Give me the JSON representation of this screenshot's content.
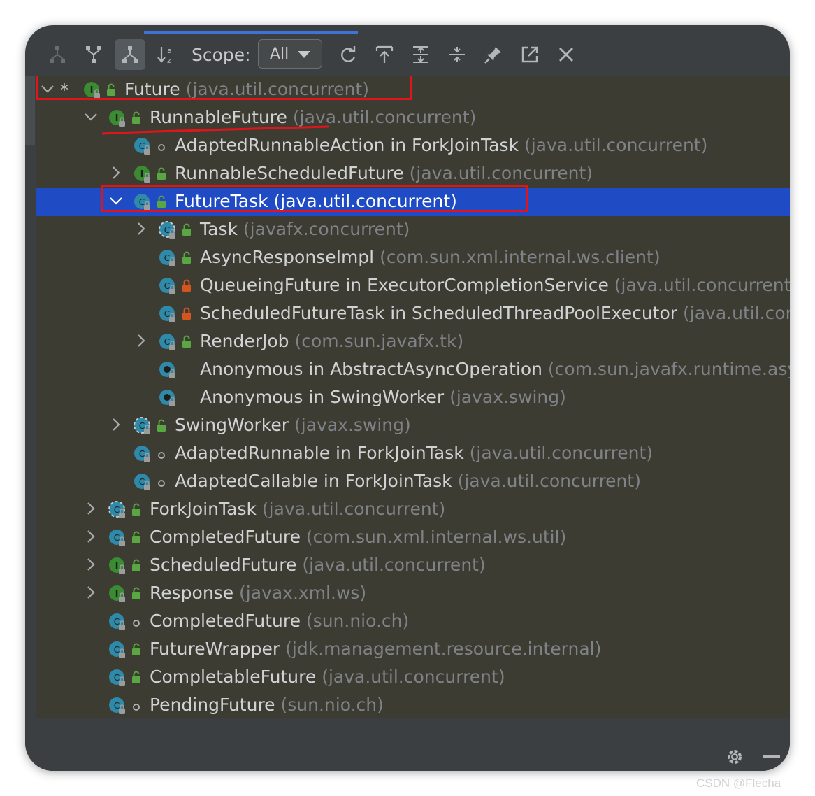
{
  "toolbar": {
    "scope_label": "Scope:",
    "scope_value": "All",
    "buttons": [
      "supertypes-hierarchy",
      "subtypes-hierarchy",
      "class-hierarchy",
      "sort-alphabetically",
      "refresh",
      "export",
      "expand-all",
      "collapse-all",
      "pin",
      "open-in-window",
      "close"
    ]
  },
  "tree": {
    "rows": [
      {
        "name": "Future",
        "pkg": "(java.util.concurrent)",
        "kind": "interface",
        "access": "public",
        "expanded": true,
        "star": "*",
        "highlighted": true
      },
      {
        "name": "RunnableFuture",
        "pkg": "(java.util.concurrent)",
        "kind": "interface",
        "access": "public",
        "expanded": true,
        "underlined": true
      },
      {
        "name": "AdaptedRunnableAction in ForkJoinTask",
        "pkg": "(java.util.concurrent)",
        "kind": "class",
        "access": "package"
      },
      {
        "name": "RunnableScheduledFuture",
        "pkg": "(java.util.concurrent)",
        "kind": "interface",
        "access": "public",
        "expanded": false
      },
      {
        "name": "FutureTask (java.util.concurrent)",
        "pkg": "",
        "kind": "class",
        "access": "public",
        "expanded": true,
        "selected": true,
        "highlighted": true
      },
      {
        "name": "Task",
        "pkg": "(javafx.concurrent)",
        "kind": "abstract-class",
        "access": "public",
        "expanded": false
      },
      {
        "name": "AsyncResponseImpl",
        "pkg": "(com.sun.xml.internal.ws.client)",
        "kind": "class",
        "access": "public"
      },
      {
        "name": "QueueingFuture in ExecutorCompletionService",
        "pkg": "(java.util.concurrent)",
        "kind": "class",
        "access": "private"
      },
      {
        "name": "ScheduledFutureTask in ScheduledThreadPoolExecutor",
        "pkg": "(java.util.con",
        "kind": "class",
        "access": "private"
      },
      {
        "name": "RenderJob",
        "pkg": "(com.sun.javafx.tk)",
        "kind": "class",
        "access": "public",
        "expanded": false
      },
      {
        "name": "Anonymous in AbstractAsyncOperation",
        "pkg": "(com.sun.javafx.runtime.asy",
        "kind": "anonymous"
      },
      {
        "name": "Anonymous in SwingWorker",
        "pkg": "(javax.swing)",
        "kind": "anonymous"
      },
      {
        "name": "SwingWorker",
        "pkg": "(javax.swing)",
        "kind": "abstract-class",
        "access": "public",
        "expanded": false
      },
      {
        "name": "AdaptedRunnable in ForkJoinTask",
        "pkg": "(java.util.concurrent)",
        "kind": "class",
        "access": "package"
      },
      {
        "name": "AdaptedCallable in ForkJoinTask",
        "pkg": "(java.util.concurrent)",
        "kind": "class",
        "access": "package"
      },
      {
        "name": "ForkJoinTask",
        "pkg": "(java.util.concurrent)",
        "kind": "abstract-class",
        "access": "public",
        "expanded": false
      },
      {
        "name": "CompletedFuture",
        "pkg": "(com.sun.xml.internal.ws.util)",
        "kind": "class",
        "access": "public",
        "expanded": false
      },
      {
        "name": "ScheduledFuture",
        "pkg": "(java.util.concurrent)",
        "kind": "interface",
        "access": "public",
        "expanded": false
      },
      {
        "name": "Response",
        "pkg": "(javax.xml.ws)",
        "kind": "interface",
        "access": "public",
        "expanded": false
      },
      {
        "name": "CompletedFuture",
        "pkg": "(sun.nio.ch)",
        "kind": "class",
        "access": "package"
      },
      {
        "name": "FutureWrapper",
        "pkg": "(jdk.management.resource.internal)",
        "kind": "class",
        "access": "public"
      },
      {
        "name": "CompletableFuture",
        "pkg": "(java.util.concurrent)",
        "kind": "class",
        "access": "public"
      },
      {
        "name": "PendingFuture",
        "pkg": "(sun.nio.ch)",
        "kind": "class",
        "access": "package"
      }
    ]
  },
  "colors": {
    "selection": "#1f4bc4",
    "highlight_box": "#e2141b",
    "interface_icon": "#3a8b32",
    "class_icon": "#2e8aa8"
  },
  "watermark": "CSDN @Flecha"
}
